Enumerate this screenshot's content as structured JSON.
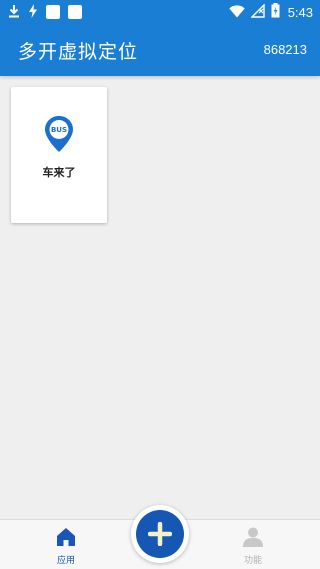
{
  "status_bar": {
    "time": "5:43",
    "left_icons": [
      "download-icon",
      "flash-icon",
      "square-notification-icon",
      "square-notification-icon"
    ],
    "right_icons": [
      "wifi-icon",
      "no-signal-icon",
      "battery-icon"
    ]
  },
  "app_bar": {
    "title": "多开虚拟定位",
    "code": "868213",
    "color": "#1a7fd4"
  },
  "apps": [
    {
      "name": "车来了",
      "icon": "bus-location-pin-icon",
      "icon_text": "BUS",
      "icon_color": "#1a6fd0"
    }
  ],
  "bottom_nav": {
    "items": [
      {
        "label": "应用",
        "icon": "home-icon",
        "active": true,
        "color": "#1a56b8"
      },
      {
        "label": "功能",
        "icon": "person-icon",
        "active": false,
        "color": "#b0b0b0"
      }
    ],
    "fab": {
      "icon": "plus-icon",
      "color": "#1657b4",
      "plus_color": "#f5f0c8"
    }
  }
}
